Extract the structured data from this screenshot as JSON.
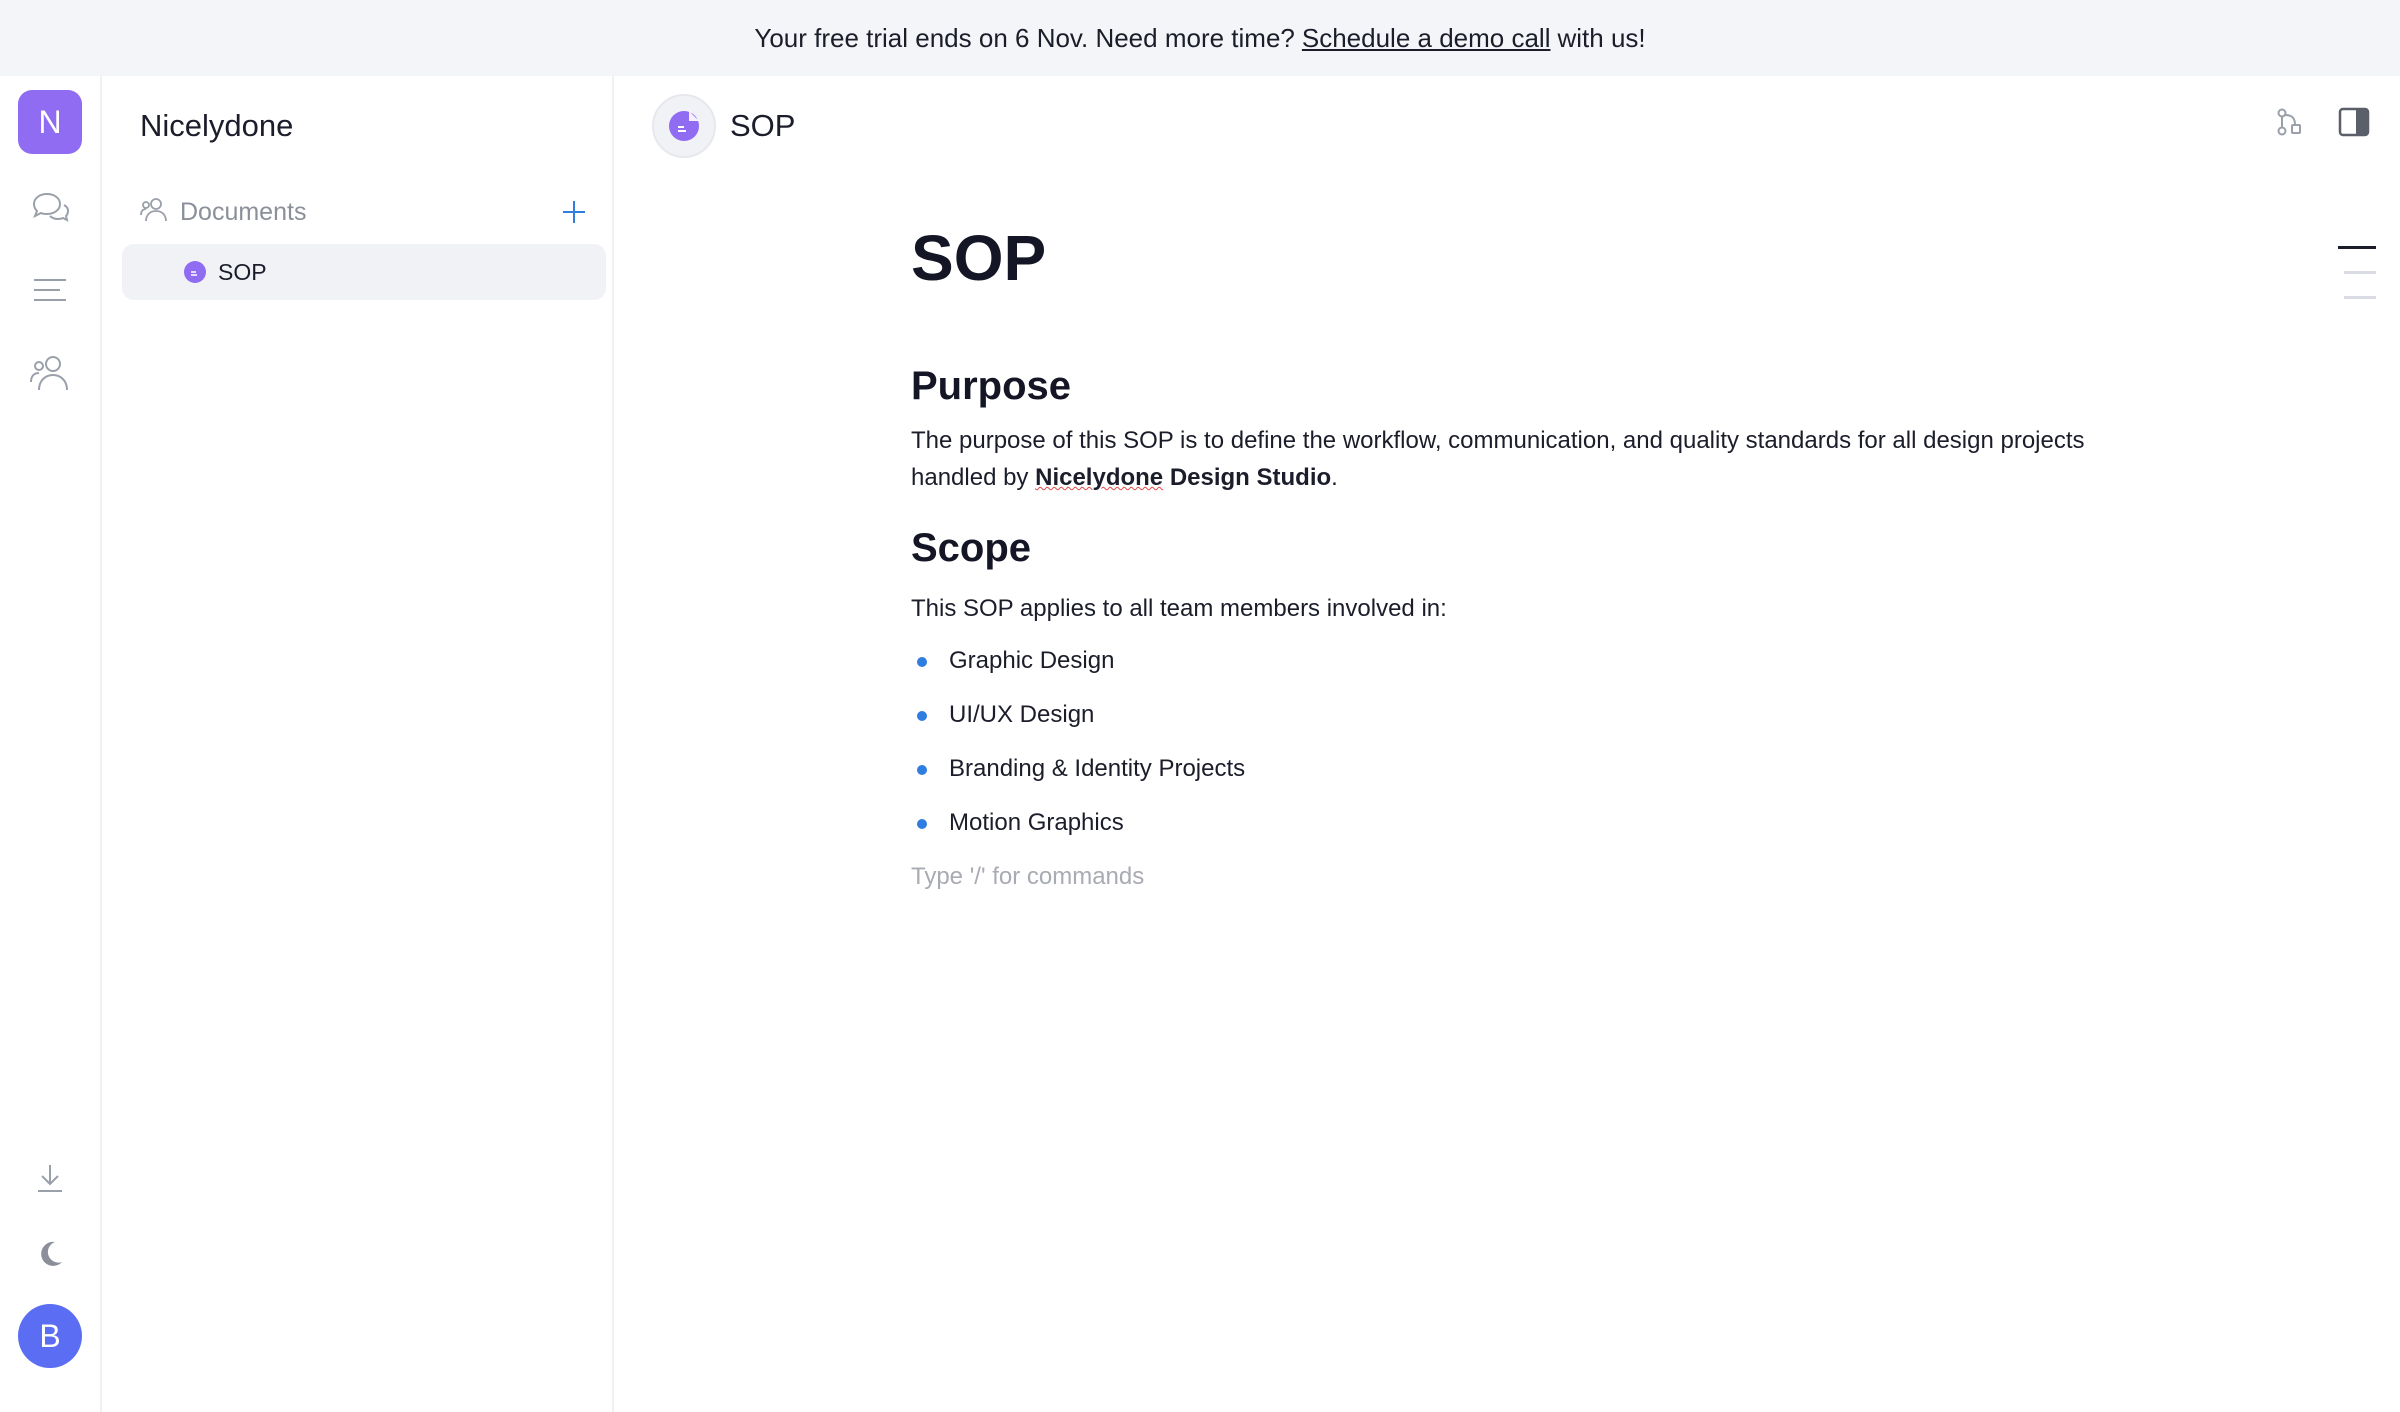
{
  "banner": {
    "prefix": "Your free trial ends on 6 Nov. Need more time?",
    "link": "Schedule a demo call",
    "suffix": "with us!"
  },
  "rail": {
    "workspace_initial": "N",
    "user_initial": "B",
    "icons": [
      "chat-icon",
      "list-icon",
      "people-icon",
      "download-icon",
      "moon-icon"
    ]
  },
  "sidebar": {
    "workspace_name": "Nicelydone",
    "section_label": "Documents",
    "items": [
      {
        "label": "SOP"
      }
    ]
  },
  "header": {
    "doc_title": "SOP"
  },
  "document": {
    "title": "SOP",
    "purpose_heading": "Purpose",
    "purpose_text_1": "The purpose of this SOP is to define the workflow, communication, and quality standards for all design projects handled by ",
    "purpose_bold_1": "Nicelydone",
    "purpose_bold_2": " Design Studio",
    "purpose_end": ".",
    "scope_heading": "Scope",
    "scope_intro": "This SOP applies to all team members involved in:",
    "scope_items": [
      "Graphic Design",
      "UI/UX Design",
      "Branding & Identity Projects",
      "Motion Graphics"
    ],
    "placeholder": "Type '/' for commands"
  },
  "colors": {
    "accent": "#8f6cf2",
    "user_avatar": "#5b6ef3",
    "bullet": "#2f7de0",
    "banner_bg": "#f4f5f8"
  }
}
